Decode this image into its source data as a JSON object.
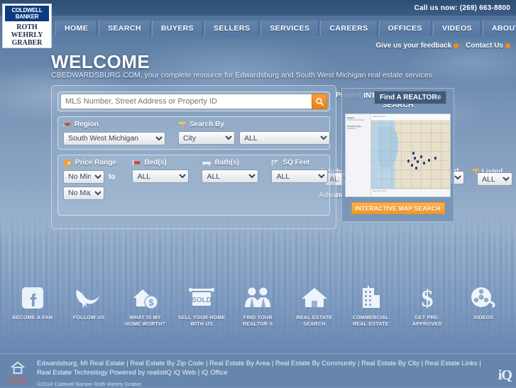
{
  "topbar": {
    "phone": "Call us now: (269) 663-8800"
  },
  "logo": {
    "brand_line1": "COLDWELL",
    "brand_line2": "BANKER",
    "office_line1": "ROTH",
    "office_line2": "WEHRLY",
    "office_line3": "GRABER"
  },
  "nav": {
    "items": [
      {
        "label": "HOME"
      },
      {
        "label": "SEARCH"
      },
      {
        "label": "BUYERS"
      },
      {
        "label": "SELLERS"
      },
      {
        "label": "SERVICES"
      },
      {
        "label": "CAREERS"
      },
      {
        "label": "OFFICES"
      },
      {
        "label": "VIDEOS"
      },
      {
        "label": "ABOUT US"
      }
    ]
  },
  "utility": {
    "feedback": "Give us your feedback",
    "contact": "Contact Us"
  },
  "hero": {
    "title": "WELCOME",
    "subtitle": "CBEDWARDSBURG.COM, your complete resource for Edwardsburg and South West Michigan real estate services."
  },
  "search": {
    "quick_placeholder": "MLS Number, Street Address or Property ID",
    "quick_value": "",
    "search_icon": "magnifier-icon",
    "region_label": "Region",
    "region_value": "South West Michigan",
    "region_options": [
      "South West Michigan"
    ],
    "searchby_label": "Search By",
    "searchby_value": "City",
    "searchby_options": [
      "City"
    ],
    "searchby_all_value": "ALL",
    "searchby_all_options": [
      "ALL"
    ],
    "price_label": "Price Range",
    "price_min_value": "No Min",
    "price_min_options": [
      "No Min"
    ],
    "price_to": "to",
    "price_max_value": "No Max",
    "price_max_options": [
      "No Max"
    ],
    "beds_label": "Bed(s)",
    "beds_value": "ALL",
    "beds_options": [
      "ALL"
    ],
    "baths_label": "Bath(s)",
    "baths_value": "ALL",
    "baths_options": [
      "ALL"
    ],
    "sqft_label": "SQ Feet",
    "sqft_value": "ALL",
    "sqft_options": [
      "ALL"
    ],
    "school_label": "School",
    "school_value": "ALL",
    "school_options": [
      "ALL"
    ],
    "reduced_label": "Reduced",
    "reduced_value": "ALL",
    "reduced_options": [
      "ALL"
    ],
    "listed_label": "Listed",
    "listed_value": "ALL",
    "listed_options": [
      "ALL"
    ],
    "advanced_label": "Advanced",
    "property_search_label": "Property Search"
  },
  "map_overlay": {
    "title_line1": "INTERACTIVE MAP",
    "title_line2": "SEARCH",
    "button_label": "INTERACTIVE MAP SEARCH",
    "thumb_side_heading": "Region",
    "thumb_side_sub": "South West Michigan",
    "thumb_side_heading2": "Property Type",
    "thumb_side_sub2": "Residential",
    "thumb_toolbar": "Bird's eye view",
    "thumb_footer": "Map data ©2013",
    "realtor_tooltip": "Find A REALTOR",
    "realtor_reg": "®"
  },
  "icon_strip": {
    "items": [
      {
        "icon": "facebook-icon",
        "label_line1": "BECOME A FAN",
        "label_line2": ""
      },
      {
        "icon": "twitter-bird-icon",
        "label_line1": "FOLLOW US",
        "label_line2": ""
      },
      {
        "icon": "home-value-icon",
        "label_line1": "WHAT IS MY",
        "label_line2": "HOME WORTH?"
      },
      {
        "icon": "sold-sign-icon",
        "label_line1": "SELL YOUR HOME",
        "label_line2": "WITH US"
      },
      {
        "icon": "realtors-icon",
        "label_line1": "FIND YOUR",
        "label_line2": "REALTOR ®"
      },
      {
        "icon": "house-icon",
        "label_line1": "REAL ESTATE",
        "label_line2": "SEARCH"
      },
      {
        "icon": "building-icon",
        "label_line1": "COMMERCIAL",
        "label_line2": "REAL ESTATE"
      },
      {
        "icon": "dollar-icon",
        "label_line1": "GET PRE-",
        "label_line2": "APPROVED"
      },
      {
        "icon": "film-reel-icon",
        "label_line1": "VIDEOS",
        "label_line2": ""
      }
    ]
  },
  "footer": {
    "links": "Edwardsburg, MI Real Estate | Real Estate By Zip Code | Real Estate By Area | Real Estate By Community | Real Estate By City | Real Estate Links | Real Estate Technology Powered by realistiQ iQ Web | iQ Office",
    "copyright": "©2014 Coldwell Banker Roth Wehrly Graber",
    "eho_icon": "equal-housing-opportunity-icon",
    "eho_text": "EQUAL HOUSING OPPORTUNITY",
    "iq_logo": "iQ"
  },
  "colors": {
    "accent_orange": "#f09a29",
    "nav_blue": "#3a5c85",
    "footer_blue": "#6786ae",
    "brand_navy": "#0b3b7c"
  }
}
